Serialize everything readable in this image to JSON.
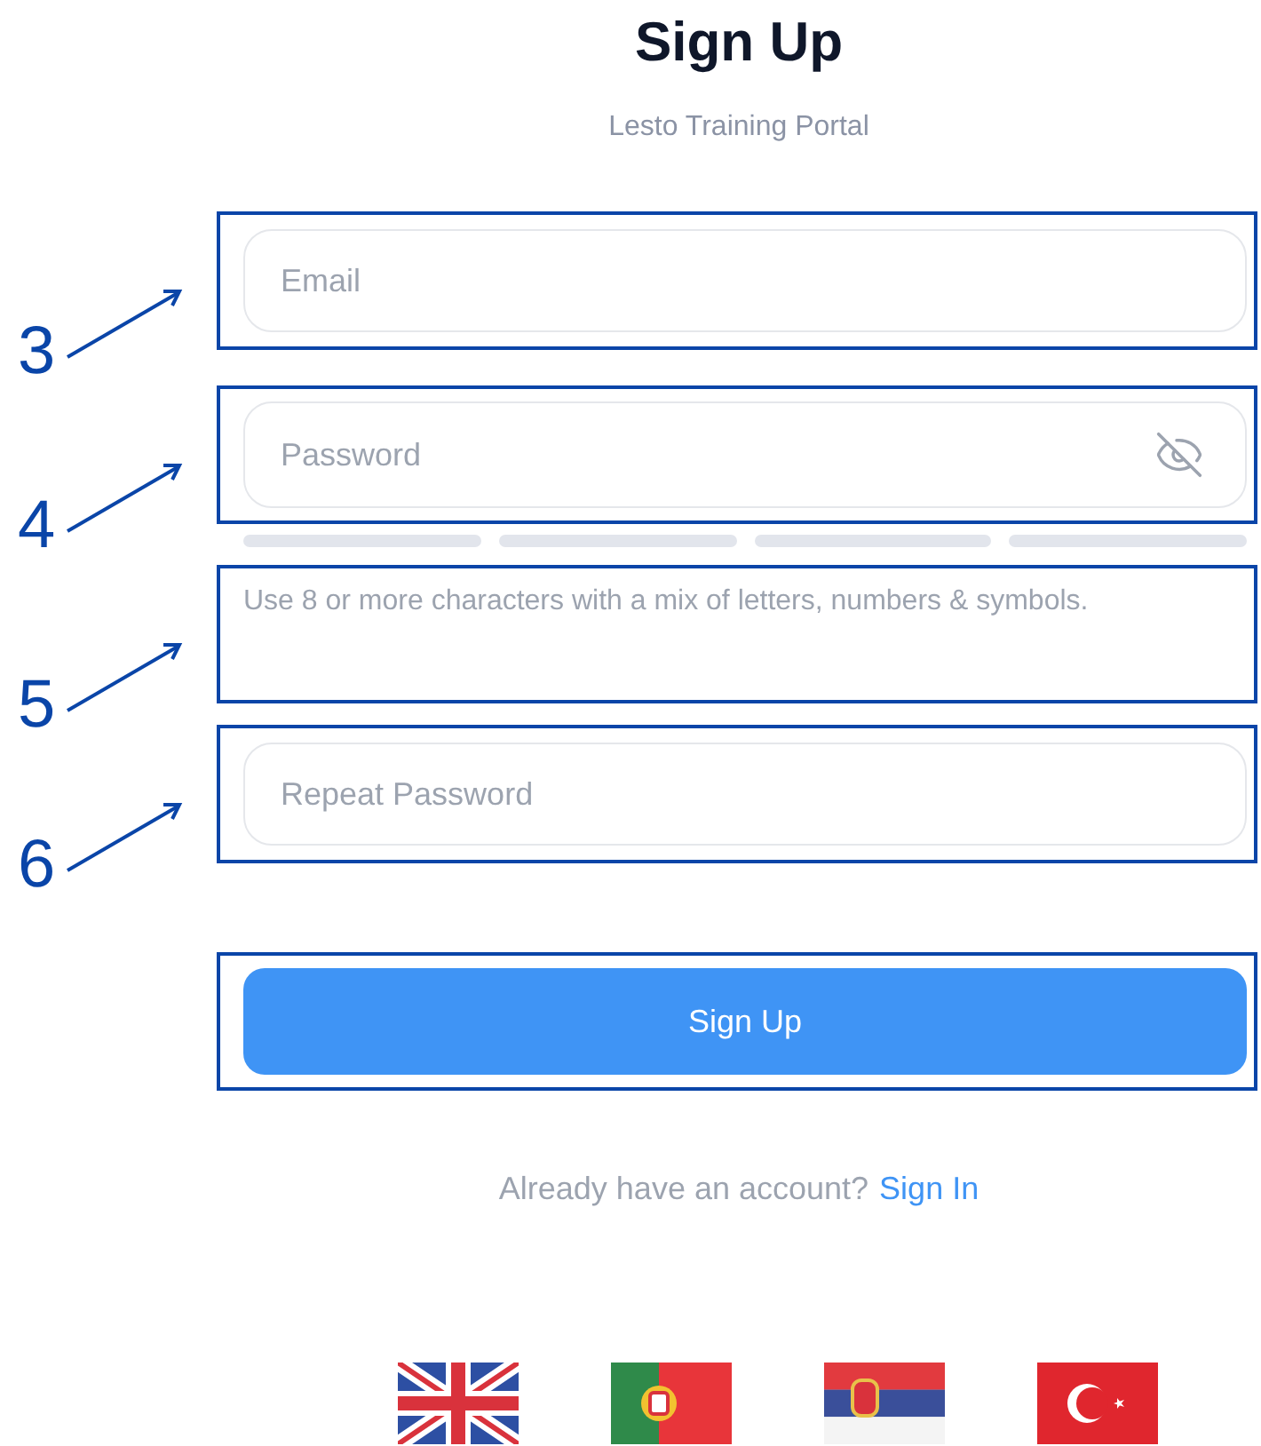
{
  "title": "Sign Up",
  "subtitle": "Lesto Training Portal",
  "sections": [
    {
      "kind": "field",
      "annotation": "3",
      "placeholder": "Email"
    },
    {
      "kind": "password",
      "annotation": "4",
      "placeholder": "Password"
    },
    {
      "kind": "hint",
      "annotation": "5",
      "text": "Use 8 or more characters with a mix of letters, numbers & symbols."
    },
    {
      "kind": "field",
      "annotation": "6",
      "placeholder": "Repeat Password"
    },
    {
      "kind": "button",
      "label": "Sign Up"
    }
  ],
  "signin_prompt": {
    "text": "Already have an account?",
    "link": "Sign In"
  },
  "languages": [
    {
      "kind": "uk"
    },
    {
      "kind": "pt"
    },
    {
      "kind": "rs"
    },
    {
      "kind": "tr"
    }
  ]
}
